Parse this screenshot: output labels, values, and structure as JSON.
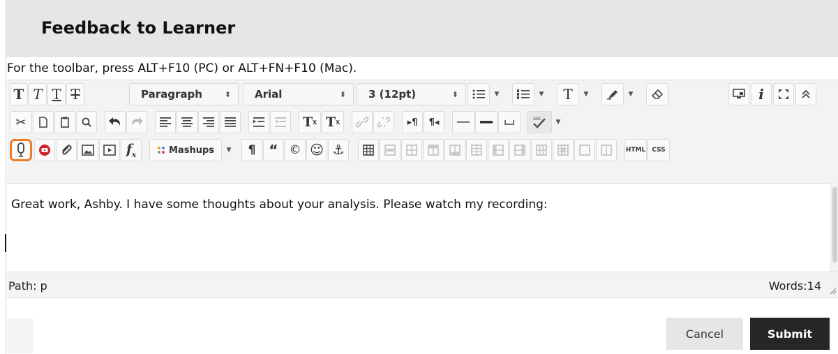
{
  "header": {
    "title": "Feedback to Learner"
  },
  "hint": "For the toolbar, press ALT+F10 (PC) or ALT+FN+F10 (Mac).",
  "toolbar": {
    "format_select": "Paragraph",
    "font_select": "Arial",
    "size_select": "3 (12pt)",
    "mashups_label": "Mashups",
    "html_label": "HTML",
    "css_label": "CSS",
    "superscript": "T",
    "subscript": "T",
    "spell_label": "ABC"
  },
  "editor": {
    "content": "Great work, Ashby. I have some thoughts about your analysis. Please watch my recording:"
  },
  "status": {
    "path": "Path: p",
    "words": "Words:14"
  },
  "actions": {
    "cancel_label": "Cancel",
    "submit_label": "Submit"
  },
  "colors": {
    "highlight": "#f07c2a",
    "submit_bg": "#262626",
    "header_bg": "#e6e6e6"
  }
}
